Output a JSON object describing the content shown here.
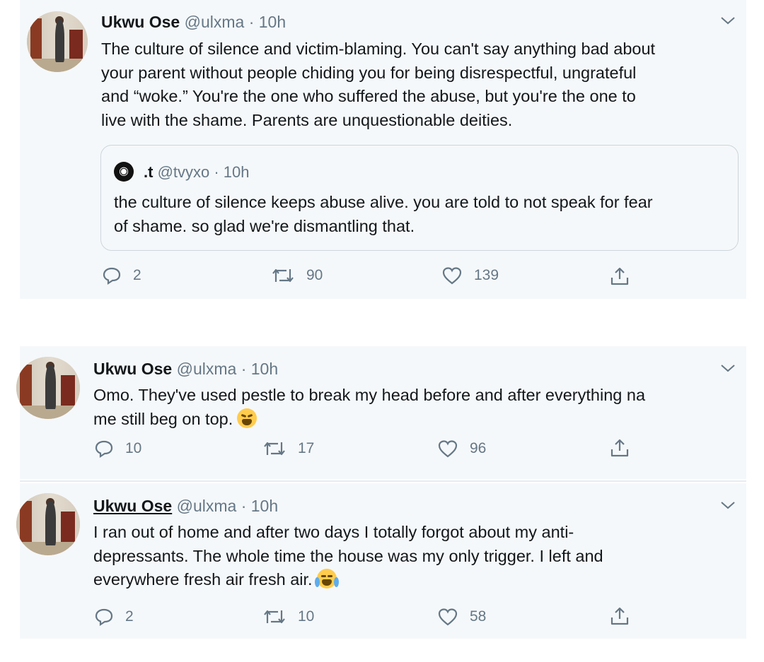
{
  "colors": {
    "text": "#14171a",
    "muted": "#657786",
    "card": "#f5f8fa",
    "border": "#ccd6dd"
  },
  "tweets": [
    {
      "name": "Ukwu Ose",
      "meta": "@ulxma · 10h",
      "avatar": "profile-photo",
      "lines": [
        "The culture of silence and victim-blaming. You can't say anything bad about",
        "your parent without people chiding you for being disrespectful, ungrateful",
        "and “woke.” You're the one who suffered the abuse, but you're the one to",
        "live with the shame. Parents are unquestionable deities."
      ],
      "quote": {
        "icon": "circle-avatar-icon",
        "name": ".t",
        "meta": "@tvyxo · 10h",
        "lines": [
          "the culture of silence keeps abuse alive. you are told to not speak for fear",
          "of shame. so glad we're dismantling that."
        ]
      },
      "replies": "2",
      "retweets": "90",
      "likes": "139"
    },
    {
      "name": "Ukwu Ose",
      "meta": "@ulxma · 10h",
      "avatar": "profile-photo",
      "lines": [
        "Omo. They've used pestle to break my head before and after everything na",
        "me still beg on top."
      ],
      "emoji": "weary-face-emoji",
      "replies": "10",
      "retweets": "17",
      "likes": "96"
    },
    {
      "name": "Ukwu Ose",
      "meta": "@ulxma · 10h",
      "avatar": "profile-photo",
      "lines": [
        "I ran out of home and after two days I totally forgot about my anti-",
        "depressants. The whole time the house was my only trigger. I left and",
        "everywhere fresh air fresh air."
      ],
      "emoji": "tears-of-joy-emoji",
      "replies": "2",
      "retweets": "10",
      "likes": "58"
    }
  ]
}
